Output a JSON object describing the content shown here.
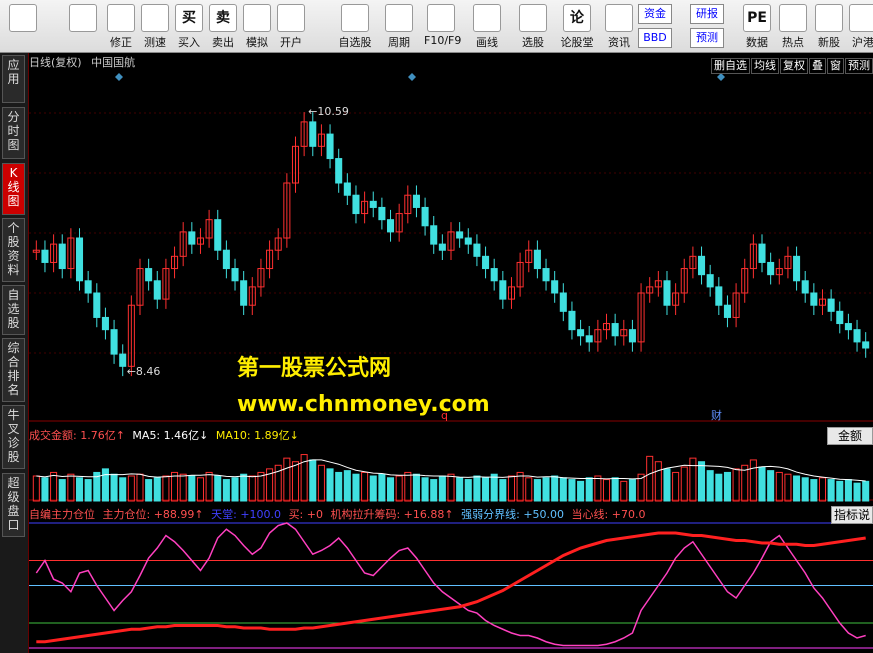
{
  "toolbar": {
    "buttons": [
      {
        "label": "",
        "icon": "grid-icon"
      },
      {
        "label": "",
        "icon": "back-arrow-icon"
      },
      {
        "label": "修正",
        "icon": "fix-icon"
      },
      {
        "label": "测速",
        "icon": "clock-icon"
      },
      {
        "label": "买入",
        "icon": "buy-icon",
        "glyph": "买"
      },
      {
        "label": "卖出",
        "icon": "sell-icon",
        "glyph": "卖"
      },
      {
        "label": "模拟",
        "icon": "hammer-icon"
      },
      {
        "label": "开户",
        "icon": "lock-icon"
      },
      {
        "label": "自选股",
        "icon": "star-icon"
      },
      {
        "label": "周期",
        "icon": "period-icon"
      },
      {
        "label": "F10/F9",
        "icon": "f10-icon"
      },
      {
        "label": "画线",
        "icon": "pen-icon"
      },
      {
        "label": "选股",
        "icon": "screen-icon"
      },
      {
        "label": "论股堂",
        "icon": "forum-icon",
        "glyph": "论"
      },
      {
        "label": "资讯",
        "icon": "news-icon"
      },
      {
        "label": "资金",
        "icon": "fund-icon"
      },
      {
        "label": "BBD",
        "icon": "bbd-icon"
      },
      {
        "label": "研报",
        "icon": "report-icon"
      },
      {
        "label": "预测",
        "icon": "forecast-icon"
      },
      {
        "label": "数据",
        "icon": "pe-icon",
        "glyph": "PE"
      },
      {
        "label": "热点",
        "icon": "fire-icon"
      },
      {
        "label": "新股",
        "icon": "ipo-icon"
      },
      {
        "label": "沪港",
        "icon": "sshk-icon"
      }
    ]
  },
  "sidetabs": [
    "应用",
    "分时图",
    "K线图",
    "个股资料",
    "自选股",
    "综合排名",
    "牛叉诊股",
    "超级盘口"
  ],
  "header": {
    "title": "日线(复权)",
    "stock": "中国国航",
    "buttons": [
      "删自选",
      "均线",
      "复权",
      "叠",
      "窗",
      "预测"
    ]
  },
  "chart_data": {
    "type": "candlestick",
    "price_high_label": "10.59",
    "price_low_label": "8.46",
    "ylim": [
      8.2,
      10.9
    ],
    "close": [
      9.45,
      9.35,
      9.5,
      9.3,
      9.55,
      9.2,
      9.1,
      8.9,
      8.8,
      8.6,
      8.5,
      9.0,
      9.3,
      9.2,
      9.05,
      9.3,
      9.4,
      9.6,
      9.5,
      9.55,
      9.7,
      9.45,
      9.3,
      9.2,
      9.0,
      9.15,
      9.3,
      9.45,
      9.55,
      10.0,
      10.3,
      10.5,
      10.3,
      10.4,
      10.2,
      10.0,
      9.9,
      9.75,
      9.85,
      9.8,
      9.7,
      9.6,
      9.75,
      9.9,
      9.8,
      9.65,
      9.5,
      9.45,
      9.6,
      9.55,
      9.5,
      9.4,
      9.3,
      9.2,
      9.05,
      9.15,
      9.35,
      9.45,
      9.3,
      9.2,
      9.1,
      8.95,
      8.8,
      8.75,
      8.7,
      8.8,
      8.85,
      8.75,
      8.8,
      8.7,
      9.1,
      9.15,
      9.2,
      9.0,
      9.1,
      9.3,
      9.4,
      9.25,
      9.15,
      9.0,
      8.9,
      9.1,
      9.3,
      9.5,
      9.35,
      9.25,
      9.3,
      9.4,
      9.2,
      9.1,
      9.0,
      9.05,
      8.95,
      8.85,
      8.8,
      8.7,
      8.65
    ],
    "volume_label": "成交金额: 1.76亿↑",
    "ma5_label": "MA5: 1.46亿↓",
    "ma10_label": "MA10: 1.89亿↓",
    "volume_unit_label": "金额",
    "volume": [
      1.4,
      1.3,
      1.6,
      1.2,
      1.5,
      1.3,
      1.2,
      1.6,
      1.8,
      1.5,
      1.3,
      1.4,
      1.5,
      1.2,
      1.3,
      1.4,
      1.6,
      1.5,
      1.4,
      1.3,
      1.6,
      1.4,
      1.2,
      1.3,
      1.5,
      1.4,
      1.6,
      1.8,
      2.0,
      2.4,
      2.2,
      2.6,
      2.3,
      2.0,
      1.8,
      1.6,
      1.7,
      1.5,
      1.6,
      1.4,
      1.5,
      1.3,
      1.4,
      1.6,
      1.5,
      1.3,
      1.2,
      1.4,
      1.5,
      1.3,
      1.2,
      1.4,
      1.3,
      1.5,
      1.2,
      1.4,
      1.6,
      1.3,
      1.2,
      1.3,
      1.4,
      1.3,
      1.2,
      1.1,
      1.3,
      1.4,
      1.2,
      1.3,
      1.1,
      1.2,
      1.5,
      2.5,
      2.2,
      1.8,
      1.6,
      1.9,
      2.4,
      2.2,
      1.7,
      1.5,
      1.6,
      1.8,
      2.0,
      2.3,
      1.9,
      1.7,
      1.6,
      1.5,
      1.4,
      1.3,
      1.2,
      1.3,
      1.2,
      1.1,
      1.2,
      1.0,
      1.1
    ],
    "indicator_labels": {
      "name": "自编主力仓位",
      "main": "主力仓位: +88.99↑",
      "sky": "天堂: +100.0",
      "buy": "买: +0",
      "inst": "机构拉升筹码: +16.88↑",
      "strong": "强弱分界线: +50.00",
      "careful": "当心线: +70.0"
    },
    "indicator_button": "指标说",
    "pink_line": [
      60,
      70,
      55,
      52,
      45,
      60,
      62,
      50,
      40,
      30,
      38,
      45,
      58,
      72,
      80,
      90,
      85,
      78,
      70,
      62,
      72,
      88,
      95,
      90,
      82,
      75,
      80,
      92,
      98,
      100,
      95,
      85,
      75,
      78,
      82,
      88,
      80,
      70,
      60,
      58,
      65,
      72,
      78,
      80,
      72,
      62,
      52,
      45,
      40,
      35,
      30,
      28,
      22,
      18,
      15,
      12,
      10,
      10,
      8,
      5,
      3,
      2,
      2,
      2,
      2,
      2,
      3,
      5,
      8,
      12,
      30,
      40,
      50,
      60,
      72,
      80,
      85,
      75,
      65,
      55,
      45,
      40,
      50,
      60,
      72,
      85,
      90,
      80,
      70,
      60,
      48,
      40,
      30,
      20,
      12,
      8,
      10
    ],
    "red_line": [
      5,
      5,
      6,
      7,
      8,
      9,
      10,
      11,
      12,
      13,
      14,
      15,
      15,
      16,
      17,
      17,
      18,
      18,
      18,
      18,
      18,
      18,
      17,
      17,
      16,
      16,
      16,
      15,
      15,
      15,
      15,
      16,
      16,
      17,
      18,
      19,
      20,
      21,
      22,
      23,
      24,
      25,
      26,
      27,
      28,
      29,
      30,
      31,
      32,
      33,
      35,
      37,
      40,
      43,
      46,
      50,
      54,
      58,
      62,
      66,
      70,
      74,
      77,
      80,
      82,
      84,
      86,
      87,
      88,
      89,
      90,
      91,
      92,
      92,
      92,
      91,
      90,
      90,
      89,
      88,
      87,
      86,
      86,
      85,
      84,
      84,
      83,
      83,
      83,
      82,
      82,
      83,
      84,
      85,
      86,
      87,
      88
    ],
    "watermark1": "第一股票公式网",
    "watermark2": "www.chnmoney.com",
    "markers": {
      "q": "q",
      "cai": "财"
    }
  }
}
